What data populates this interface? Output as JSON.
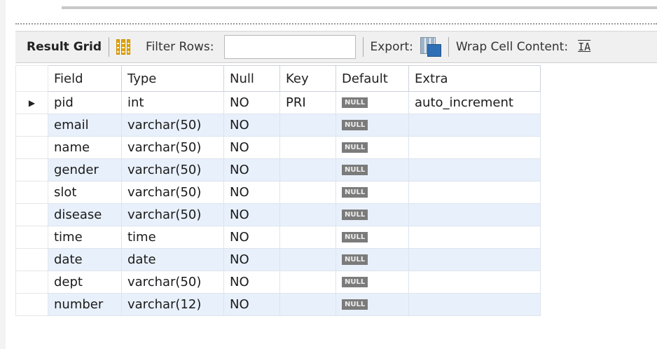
{
  "toolbar": {
    "result_grid_label": "Result Grid",
    "filter_rows_label": "Filter Rows:",
    "filter_rows_value": "",
    "export_label": "Export:",
    "wrap_label": "Wrap Cell Content:",
    "wrap_icon_glyph": "IA"
  },
  "grid": {
    "columns": [
      "Field",
      "Type",
      "Null",
      "Key",
      "Default",
      "Extra"
    ],
    "rows": [
      {
        "marker": "▶",
        "field": "pid",
        "type": "int",
        "null": "NO",
        "key": "PRI",
        "default": "NULL",
        "extra": "auto_increment"
      },
      {
        "marker": "",
        "field": "email",
        "type": "varchar(50)",
        "null": "NO",
        "key": "",
        "default": "NULL",
        "extra": ""
      },
      {
        "marker": "",
        "field": "name",
        "type": "varchar(50)",
        "null": "NO",
        "key": "",
        "default": "NULL",
        "extra": ""
      },
      {
        "marker": "",
        "field": "gender",
        "type": "varchar(50)",
        "null": "NO",
        "key": "",
        "default": "NULL",
        "extra": ""
      },
      {
        "marker": "",
        "field": "slot",
        "type": "varchar(50)",
        "null": "NO",
        "key": "",
        "default": "NULL",
        "extra": ""
      },
      {
        "marker": "",
        "field": "disease",
        "type": "varchar(50)",
        "null": "NO",
        "key": "",
        "default": "NULL",
        "extra": ""
      },
      {
        "marker": "",
        "field": "time",
        "type": "time",
        "null": "NO",
        "key": "",
        "default": "NULL",
        "extra": ""
      },
      {
        "marker": "",
        "field": "date",
        "type": "date",
        "null": "NO",
        "key": "",
        "default": "NULL",
        "extra": ""
      },
      {
        "marker": "",
        "field": "dept",
        "type": "varchar(50)",
        "null": "NO",
        "key": "",
        "default": "NULL",
        "extra": ""
      },
      {
        "marker": "",
        "field": "number",
        "type": "varchar(12)",
        "null": "NO",
        "key": "",
        "default": "NULL",
        "extra": ""
      }
    ]
  },
  "icons": {
    "result_grid": "grid-table-icon",
    "export": "export-disk-icon",
    "wrap": "wrap-text-icon"
  },
  "colors": {
    "alt_row": "#e8f0fb",
    "null_badge_bg": "#7b7b7b",
    "toolbar_bg": "#f0f0f0"
  }
}
